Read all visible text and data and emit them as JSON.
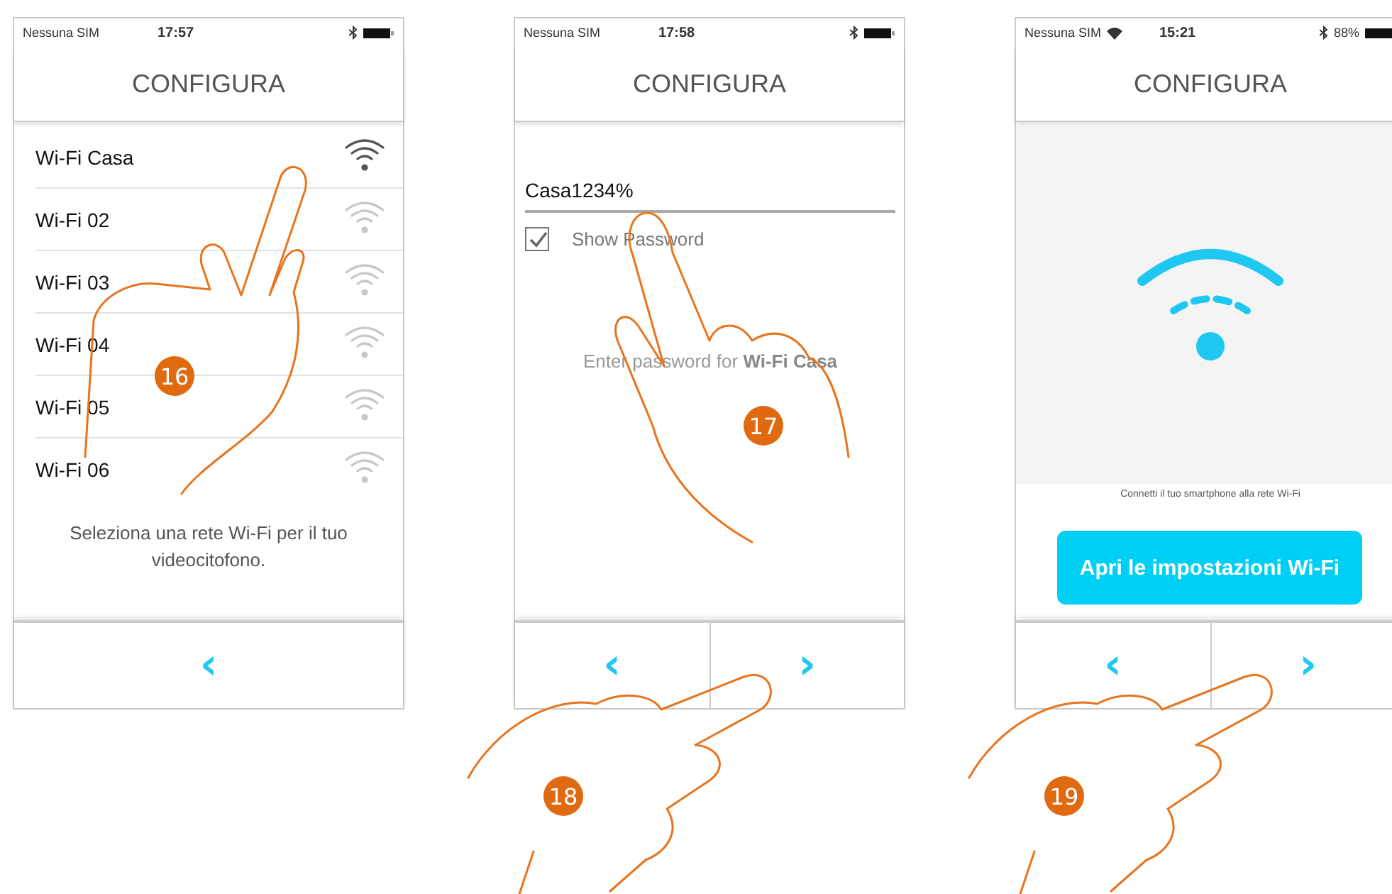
{
  "screens": [
    {
      "kind": "network_list",
      "status": {
        "carrier": "Nessuna SIM",
        "time": "17:57",
        "wifi": false
      },
      "title": "CONFIGURA",
      "networks": [
        {
          "name": "Wi-Fi Casa",
          "selected": true
        },
        {
          "name": "Wi-Fi 02",
          "selected": false
        },
        {
          "name": "Wi-Fi 03",
          "selected": false
        },
        {
          "name": "Wi-Fi 04",
          "selected": false
        },
        {
          "name": "Wi-Fi 05",
          "selected": false
        },
        {
          "name": "Wi-Fi 06",
          "selected": false
        }
      ],
      "message": "Seleziona una rete Wi-Fi per il tuo videocitofono.",
      "nav": [
        {
          "kind": "back",
          "symbol": "‹"
        }
      ]
    },
    {
      "kind": "password",
      "status": {
        "carrier": "Nessuna SIM",
        "time": "17:58",
        "wifi": false
      },
      "title": "CONFIGURA",
      "password_field": {
        "value": "Casa1234%"
      },
      "show_password": {
        "label": "Show Password",
        "checked": true
      },
      "instruction": "Enter password for **Wi-Fi Casa**",
      "nav": [
        {
          "kind": "back",
          "symbol": "‹"
        },
        {
          "kind": "next",
          "symbol": "›"
        }
      ]
    },
    {
      "kind": "wifi_settings",
      "status": {
        "carrier": "Nessuna SIM",
        "time": "15:21",
        "wifi": true,
        "battery": "88%"
      },
      "title": "CONFIGURA",
      "caption": "Connetti il tuo smartphone alla rete Wi-Fi",
      "button": "Apri le impostazioni Wi-Fi",
      "nav": [
        {
          "kind": "back",
          "symbol": "‹"
        },
        {
          "kind": "next",
          "symbol": "›"
        }
      ]
    }
  ],
  "steps": [
    "16",
    "17",
    "18",
    "19"
  ]
}
